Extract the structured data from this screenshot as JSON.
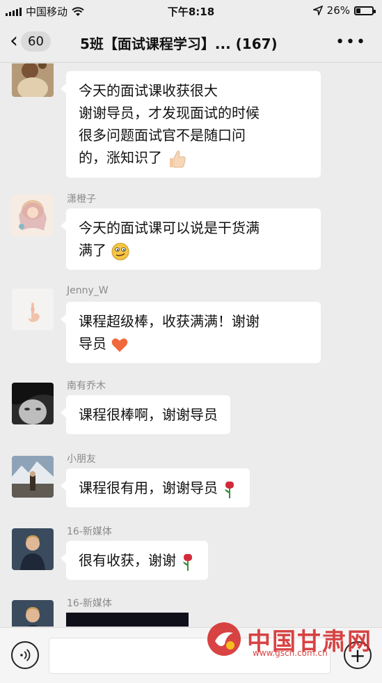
{
  "status_bar": {
    "carrier": "中国移动",
    "time": "下午8:18",
    "battery_text": "26%",
    "battery_level": 0.26
  },
  "nav": {
    "back_count": "60",
    "title": "5班【面试课程学习】... (167)",
    "more_icon": "ellipsis-icon"
  },
  "messages": [
    {
      "sender": "",
      "lines": [
        "今天的面试课收获很大",
        "谢谢导员，才发现面试的时候",
        "很多问题面试官不是随口问",
        "的，涨知识了"
      ],
      "emoji": "thumbs-up-icon"
    },
    {
      "sender": "潇橙子",
      "lines": [
        "今天的面试课可以说是干货满",
        "满了"
      ],
      "emoji": "smirk-face-icon"
    },
    {
      "sender": "Jenny_W",
      "lines": [
        "课程超级棒，收获满满！谢谢",
        "导员"
      ],
      "emoji": "orange-heart-icon"
    },
    {
      "sender": "南有乔木",
      "lines": [
        "课程很棒啊，谢谢导员"
      ],
      "emoji": ""
    },
    {
      "sender": "小朋友",
      "lines": [
        "课程很有用，谢谢导员"
      ],
      "emoji": "rose-icon"
    },
    {
      "sender": "16-新媒体",
      "lines": [
        "很有收获，谢谢"
      ],
      "emoji": "rose-icon"
    },
    {
      "sender": "16-新媒体",
      "lines": [],
      "emoji": ""
    }
  ],
  "watermark": {
    "brand": "中国甘肃网",
    "url": "www.gscn.com.cn"
  },
  "colors": {
    "background": "#ececec",
    "bubble": "#ffffff",
    "watermark_red": "#d42a2a"
  }
}
